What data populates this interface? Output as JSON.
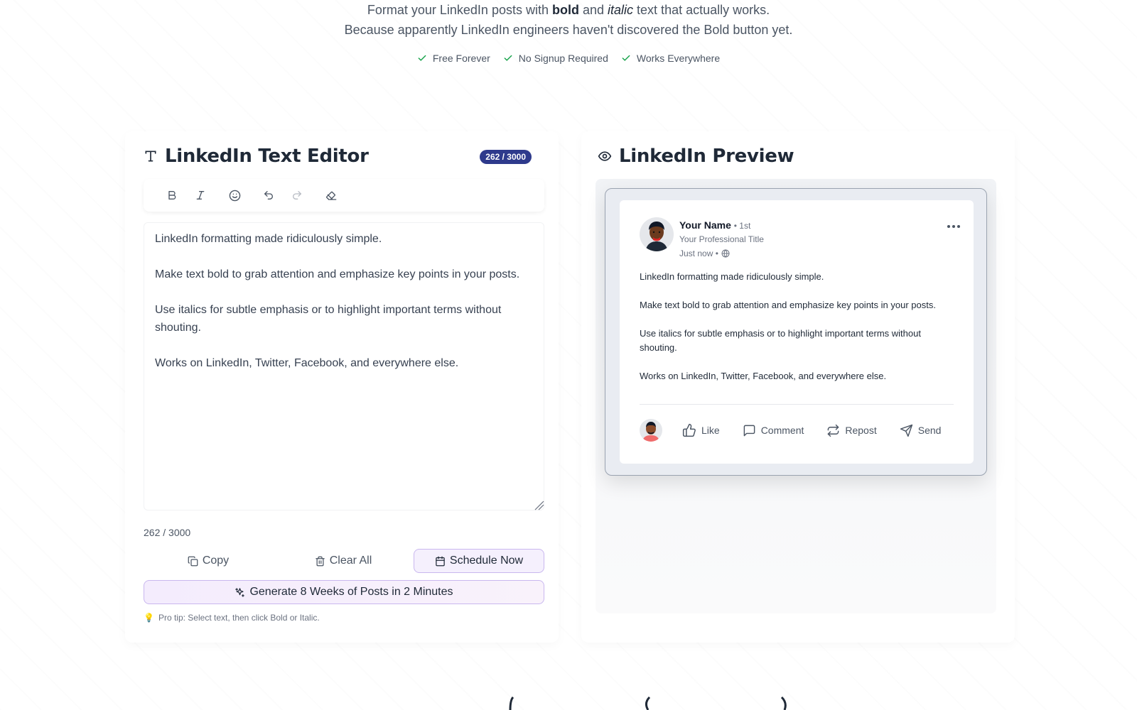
{
  "hero": {
    "line1_prefix": "Format your LinkedIn posts with ",
    "line1_bold": "bold",
    "line1_mid": " and ",
    "line1_italic": "italic",
    "line1_suffix": " text that actually works.",
    "line2": "Because apparently LinkedIn engineers haven't discovered the Bold button yet.",
    "features": [
      "Free Forever",
      "No Signup Required",
      "Works Everywhere"
    ]
  },
  "editor": {
    "title": "LinkedIn Text Editor",
    "badge": "262 / 3000",
    "text": "LinkedIn formatting made ridiculously simple.\n\nMake text bold to grab attention and emphasize key points in your posts.\n\nUse italics for subtle emphasis or to highlight important terms without shouting.\n\nWorks on LinkedIn, Twitter, Facebook, and everywhere else.",
    "char_count": "262 / 3000",
    "copy_label": "Copy",
    "clear_label": "Clear All",
    "schedule_label": "Schedule Now",
    "generate_label": "Generate 8 Weeks of Posts in 2 Minutes",
    "pro_tip": "Pro tip: Select text, then click Bold or Italic."
  },
  "preview": {
    "title": "LinkedIn Preview",
    "author_name": "Your Name",
    "degree": "• 1st",
    "author_title": "Your Professional Title",
    "time": "Just now •",
    "body": "LinkedIn formatting made ridiculously simple.\n\nMake text bold to grab attention and emphasize key points in your posts.\n\nUse italics for subtle emphasis or to highlight important terms without shouting.\n\nWorks on LinkedIn, Twitter, Facebook, and everywhere else.",
    "actions": {
      "like": "Like",
      "comment": "Comment",
      "repost": "Repost",
      "send": "Send"
    }
  },
  "colors": {
    "badge_bg": "#2e3a8c",
    "check": "#16a34a",
    "accent_border": "#c9b7ef",
    "accent_bg": "#f5f0fd"
  }
}
